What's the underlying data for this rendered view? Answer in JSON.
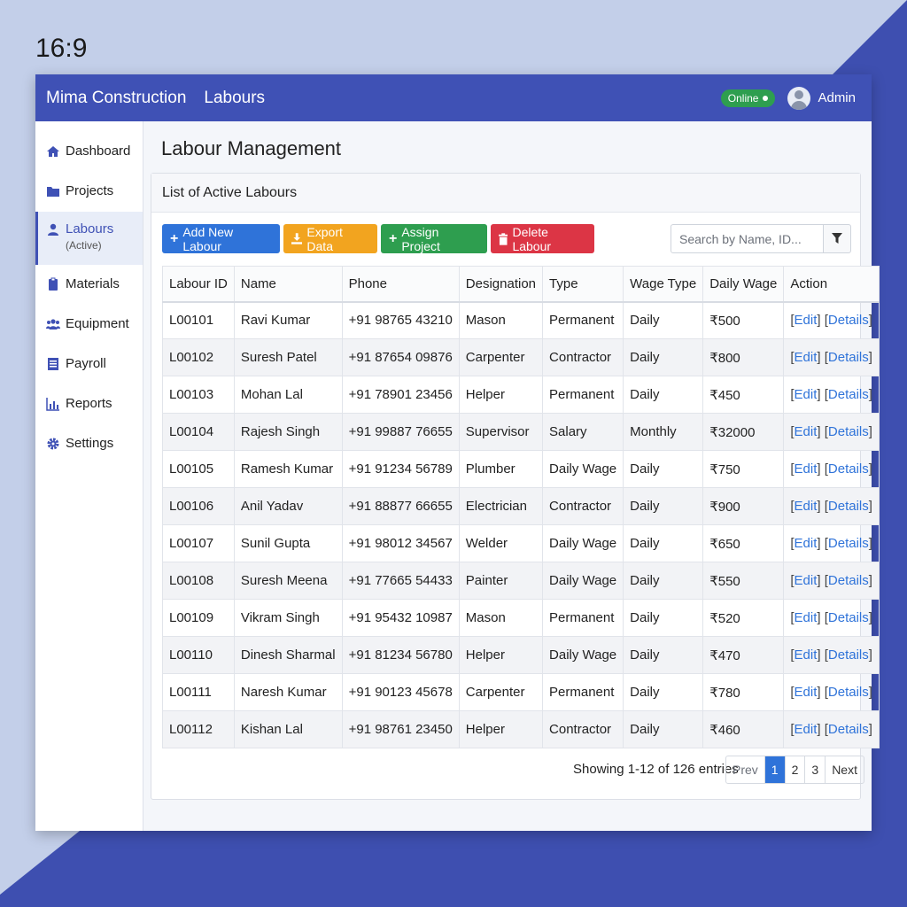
{
  "aspect_label": "16:9",
  "header": {
    "brand": "Mima Construction",
    "section": "Labours",
    "status": "Online",
    "user": "Admin"
  },
  "colors": {
    "primary": "#3f51b5",
    "blue": "#2f73d9",
    "orange": "#f2a41f",
    "green": "#2e9e4f",
    "red": "#dc3545"
  },
  "sidebar": {
    "items": [
      {
        "label": "Dashboard",
        "icon": "home-icon"
      },
      {
        "label": "Projects",
        "icon": "folder-icon"
      },
      {
        "label": "Labours",
        "sub": "(Active)",
        "icon": "user-icon",
        "active": true
      },
      {
        "label": "Materials",
        "icon": "clipboard-icon"
      },
      {
        "label": "Equipment",
        "icon": "users-icon"
      },
      {
        "label": "Payroll",
        "icon": "ledger-icon"
      },
      {
        "label": "Reports",
        "icon": "bar-chart-icon"
      },
      {
        "label": "Settings",
        "icon": "gear-icon"
      }
    ]
  },
  "page": {
    "title": "Labour Management",
    "card_title": "List of Active Labours"
  },
  "toolbar": {
    "add": "Add New Labour",
    "export": "Export Data",
    "assign": "Assign Project",
    "delete": "Delete Labour",
    "search_placeholder": "Search by Name, ID..."
  },
  "table": {
    "columns": [
      "Labour ID",
      "Name",
      "Phone",
      "Designation",
      "Type",
      "Wage Type",
      "Daily Wage",
      "Action"
    ],
    "edit_label": "Edit",
    "details_label": "Details",
    "rows": [
      [
        "L00101",
        "Ravi Kumar",
        "+91 98765 43210",
        "Mason",
        "Permanent",
        "Daily",
        "₹500"
      ],
      [
        "L00102",
        "Suresh Patel",
        "+91 87654 09876",
        "Carpenter",
        "Contractor",
        "Daily",
        "₹800"
      ],
      [
        "L00103",
        "Mohan Lal",
        "+91 78901 23456",
        "Helper",
        "Permanent",
        "Daily",
        "₹450"
      ],
      [
        "L00104",
        "Rajesh Singh",
        "+91 99887 76655",
        "Supervisor",
        "Salary",
        "Monthly",
        "₹32000"
      ],
      [
        "L00105",
        "Ramesh Kumar",
        "+91 91234 56789",
        "Plumber",
        "Daily Wage",
        "Daily",
        "₹750"
      ],
      [
        "L00106",
        "Anil Yadav",
        "+91 88877 66655",
        "Electrician",
        "Contractor",
        "Daily",
        "₹900"
      ],
      [
        "L00107",
        "Sunil Gupta",
        "+91 98012 34567",
        "Welder",
        "Daily Wage",
        "Daily",
        "₹650"
      ],
      [
        "L00108",
        "Suresh Meena",
        "+91 77665 54433",
        "Painter",
        "Daily Wage",
        "Daily",
        "₹550"
      ],
      [
        "L00109",
        "Vikram Singh",
        "+91 95432 10987",
        "Mason",
        "Permanent",
        "Daily",
        "₹520"
      ],
      [
        "L00110",
        "Dinesh Sharmal",
        "+91 81234 56780",
        "Helper",
        "Daily Wage",
        "Daily",
        "₹470"
      ],
      [
        "L00111",
        "Naresh Kumar",
        "+91 90123 45678",
        "Carpenter",
        "Permanent",
        "Daily",
        "₹780"
      ],
      [
        "L00112",
        "Kishan Lal",
        "+91 98761 23450",
        "Helper",
        "Contractor",
        "Daily",
        "₹460"
      ]
    ]
  },
  "pagination": {
    "info": "Showing 1-12 of 126 entries",
    "prev": "Prev",
    "pages": [
      "1",
      "2",
      "3"
    ],
    "current": "1",
    "next": "Next"
  }
}
